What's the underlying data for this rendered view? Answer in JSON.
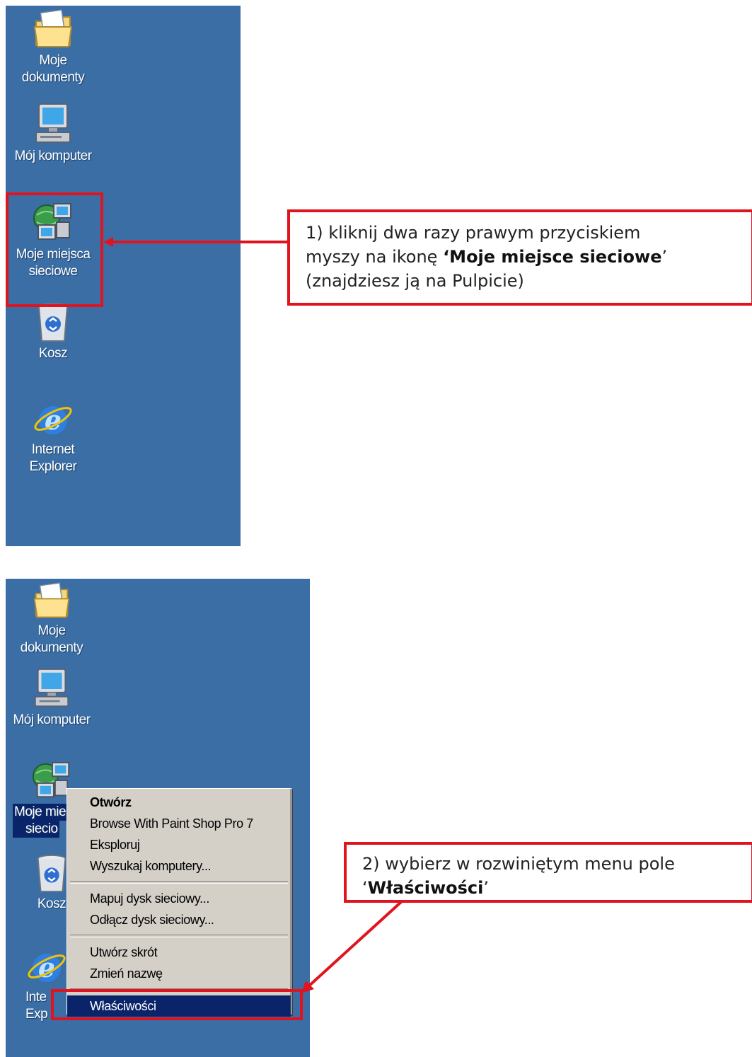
{
  "panel1": {
    "icons": [
      {
        "name": "my-documents",
        "label_line1": "Moje",
        "label_line2": "dokumenty",
        "icon": "folder-icon"
      },
      {
        "name": "my-computer",
        "label_line1": "Mój komputer",
        "label_line2": "",
        "icon": "computer-icon"
      },
      {
        "name": "network-places",
        "label_line1": "Moje miejsca",
        "label_line2": "sieciowe",
        "icon": "network-icon"
      },
      {
        "name": "recycle-bin",
        "label_line1": "Kosz",
        "label_line2": "",
        "icon": "recycle-bin-icon"
      },
      {
        "name": "internet-explorer",
        "label_line1": "Internet",
        "label_line2": "Explorer",
        "icon": "ie-icon"
      }
    ],
    "callout": {
      "line1": "1) kliknij dwa razy prawym przyciskiem",
      "line2_pre": "myszy na ikonę ",
      "line2_bold": "‘Moje miejsce sieciowe",
      "line2_post": "’",
      "line3": "(znajdziesz ją na Pulpicie)"
    }
  },
  "panel2": {
    "icons": [
      {
        "name": "my-documents",
        "label_line1": "Moje",
        "label_line2": "dokumenty",
        "icon": "folder-icon"
      },
      {
        "name": "my-computer",
        "label_line1": "Mój komputer",
        "label_line2": "",
        "icon": "computer-icon"
      },
      {
        "name": "network-places",
        "label_line1": "Moje mie",
        "label_line2": "siecio",
        "icon": "network-icon"
      },
      {
        "name": "recycle-bin",
        "label_line1": "Kosz",
        "label_line2": "",
        "icon": "recycle-bin-icon"
      },
      {
        "name": "internet-explorer",
        "label_line1": "Inte",
        "label_line2": "Exp",
        "icon": "ie-icon"
      }
    ],
    "context_menu": {
      "group1": [
        "Otwórz",
        "Browse With Paint Shop Pro 7",
        "Eksploruj",
        "Wyszukaj komputery..."
      ],
      "group2": [
        "Mapuj dysk sieciowy...",
        "Odłącz dysk sieciowy..."
      ],
      "group3": [
        "Utwórz skrót",
        "Zmień nazwę"
      ],
      "group4": [
        "Właściwości"
      ]
    },
    "callout": {
      "line1": "2) wybierz w rozwiniętym menu pole",
      "line2_pre": "‘",
      "line2_bold": "Właściwości",
      "line2_post": "’"
    }
  },
  "colors": {
    "desktop": "#3a6ea5",
    "accent_red": "#e0131f",
    "highlight": "#0a246a"
  }
}
